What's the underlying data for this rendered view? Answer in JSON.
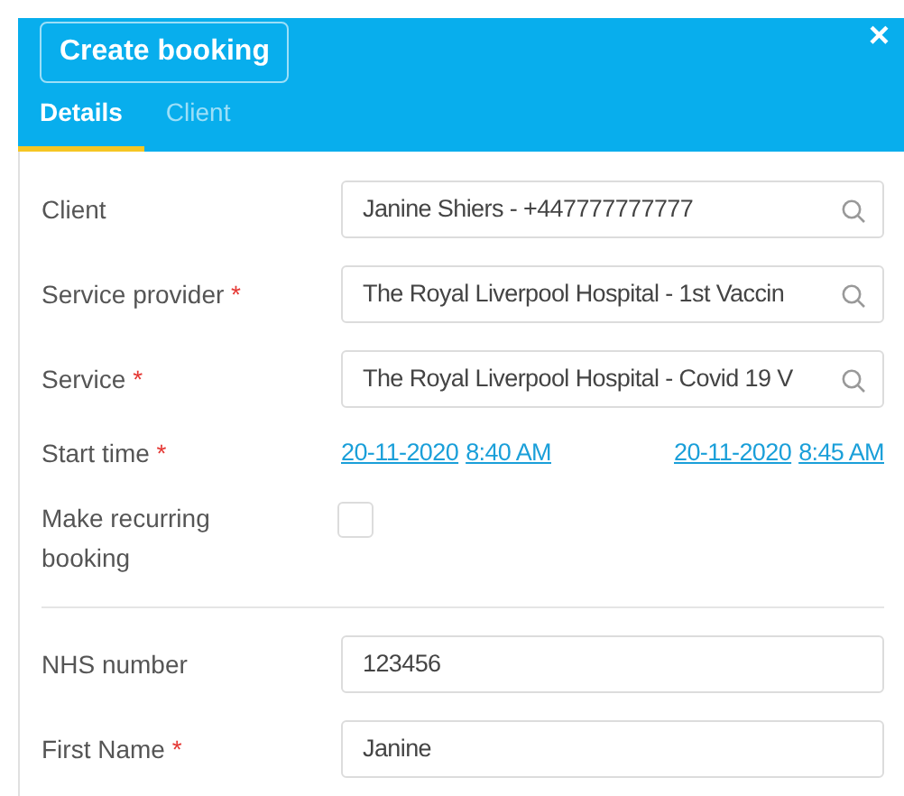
{
  "header": {
    "title_button": "Create booking",
    "close": "×"
  },
  "tabs": [
    {
      "label": "Details",
      "selected": true
    },
    {
      "label": "Client",
      "selected": false
    }
  ],
  "sections": [
    {
      "fields": [
        {
          "kind": "search",
          "label": "Client",
          "value": "Janine Shiers - +447777777777"
        },
        {
          "kind": "search",
          "label": "Service provider",
          "required_mark": "*",
          "value": "The Royal Liverpool Hospital - 1st Vaccin"
        },
        {
          "kind": "search",
          "label": "Service",
          "required_mark": "*",
          "value": "The Royal Liverpool Hospital - Covid 19 V"
        },
        {
          "kind": "datetime",
          "label": "Start time",
          "required_mark": "*",
          "ranges": [
            {
              "date": "20-11-2020",
              "time": "8:40 AM"
            },
            {
              "date": "20-11-2020",
              "time": "8:45 AM"
            }
          ]
        },
        {
          "kind": "checkbox",
          "label": "Make recurring booking",
          "checked": false
        }
      ]
    },
    {
      "fields": [
        {
          "kind": "text",
          "label": "NHS number",
          "value": "123456"
        },
        {
          "kind": "text",
          "label": "First Name",
          "required_mark": "*",
          "value": "Janine"
        }
      ]
    }
  ]
}
